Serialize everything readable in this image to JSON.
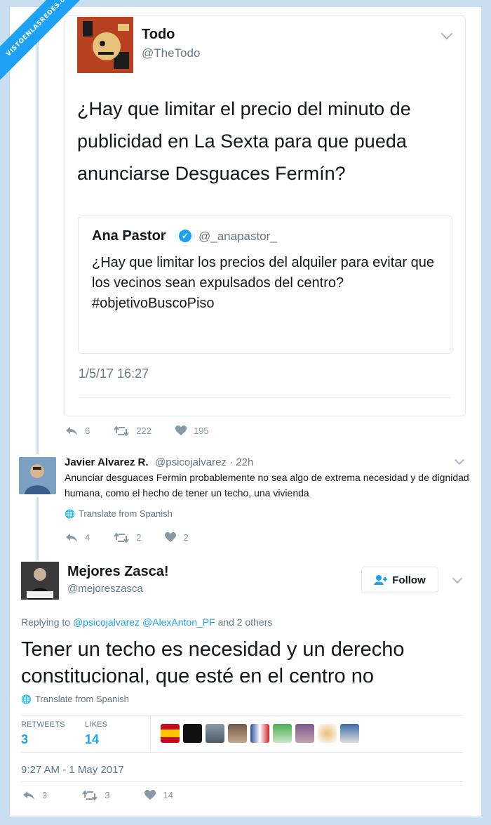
{
  "watermark": "VISTOENLASREDES.com",
  "tweet1": {
    "name": "Todo",
    "handle": "@TheTodo",
    "text": "¿Hay que limitar el precio del minuto de publicidad en La Sexta para que pueda anunciarse Desguaces Fermín?",
    "quoted": {
      "name": "Ana Pastor",
      "handle": "@_anapastor_",
      "text": "¿Hay que limitar los precios del alquiler para evitar que los vecinos sean expulsados del centro?",
      "hashtag": "#objetivoBuscoPiso"
    },
    "date": "1/5/17 16:27",
    "replies": "6",
    "retweets": "222",
    "likes": "195"
  },
  "tweet2": {
    "name": "Javier Alvarez R.",
    "meta": "@psicojalvarez · 22h",
    "text": "Anunciar desguaces Fermin probablemente no sea algo de extrema necesidad y de dignidad humana, como el hecho de tener un techo, una vivienda",
    "translate": "Translate from Spanish",
    "replies": "4",
    "retweets": "2",
    "likes": "2"
  },
  "tweet3": {
    "name": "Mejores Zasca!",
    "handle": "@mejoreszasca",
    "follow_label": "Follow",
    "replying_prefix": "Replying to",
    "replying_mentions": "@psicojalvarez @AlexAnton_PF",
    "replying_suffix": "and 2 others",
    "text": "Tener un techo es necesidad y un derecho constitucional, que esté en el centro no",
    "translate": "Translate from Spanish",
    "retweets_label": "RETWEETS",
    "retweets_value": "3",
    "likes_label": "LIKES",
    "likes_value": "14",
    "date": "9:27 AM - 1 May 2017",
    "replies": "3",
    "retweets": "3",
    "likes": "14"
  },
  "colors": {
    "accent": "#1da1f2",
    "muted": "#657786",
    "icon": "#8899a6"
  }
}
